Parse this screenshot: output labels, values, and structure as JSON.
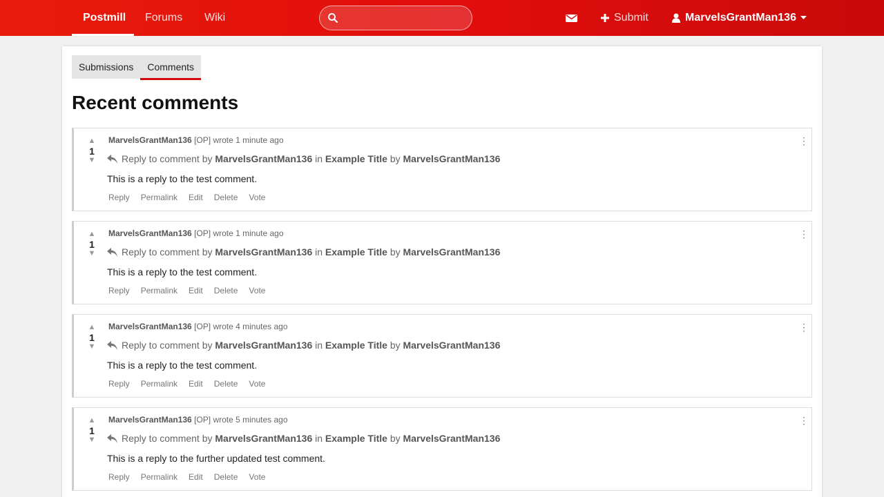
{
  "nav": {
    "brand": "Postmill",
    "forums": "Forums",
    "wiki": "Wiki",
    "search_placeholder": "",
    "submit": "Submit",
    "user": "MarvelsGrantMan136"
  },
  "tabs": [
    "Submissions",
    "Comments"
  ],
  "page_title": "Recent comments",
  "comments": [
    {
      "score": "1",
      "author": "MarvelsGrantMan136",
      "op_tag": "[OP]",
      "time": "wrote 1 minute ago",
      "reply_prefix": "Reply to comment by",
      "reply_to": "MarvelsGrantMan136",
      "in_word": "in",
      "submission_title": "Example Title",
      "by_word": "by",
      "submitter": "MarvelsGrantMan136",
      "body": "This is a reply to the test comment.",
      "actions": [
        "Reply",
        "Permalink",
        "Edit",
        "Delete",
        "Vote"
      ]
    },
    {
      "score": "1",
      "author": "MarvelsGrantMan136",
      "op_tag": "[OP]",
      "time": "wrote 1 minute ago",
      "reply_prefix": "Reply to comment by",
      "reply_to": "MarvelsGrantMan136",
      "in_word": "in",
      "submission_title": "Example Title",
      "by_word": "by",
      "submitter": "MarvelsGrantMan136",
      "body": "This is a reply to the test comment.",
      "actions": [
        "Reply",
        "Permalink",
        "Edit",
        "Delete",
        "Vote"
      ]
    },
    {
      "score": "1",
      "author": "MarvelsGrantMan136",
      "op_tag": "[OP]",
      "time": "wrote 4 minutes ago",
      "reply_prefix": "Reply to comment by",
      "reply_to": "MarvelsGrantMan136",
      "in_word": "in",
      "submission_title": "Example Title",
      "by_word": "by",
      "submitter": "MarvelsGrantMan136",
      "body": "This is a reply to the test comment.",
      "actions": [
        "Reply",
        "Permalink",
        "Edit",
        "Delete",
        "Vote"
      ]
    },
    {
      "score": "1",
      "author": "MarvelsGrantMan136",
      "op_tag": "[OP]",
      "time": "wrote 5 minutes ago",
      "reply_prefix": "Reply to comment by",
      "reply_to": "MarvelsGrantMan136",
      "in_word": "in",
      "submission_title": "Example Title",
      "by_word": "by",
      "submitter": "MarvelsGrantMan136",
      "body": "This is a reply to the further updated test comment.",
      "actions": [
        "Reply",
        "Permalink",
        "Edit",
        "Delete",
        "Vote"
      ]
    }
  ],
  "colors": {
    "brand": "#e00d0d",
    "accent": "#d40a0a"
  }
}
